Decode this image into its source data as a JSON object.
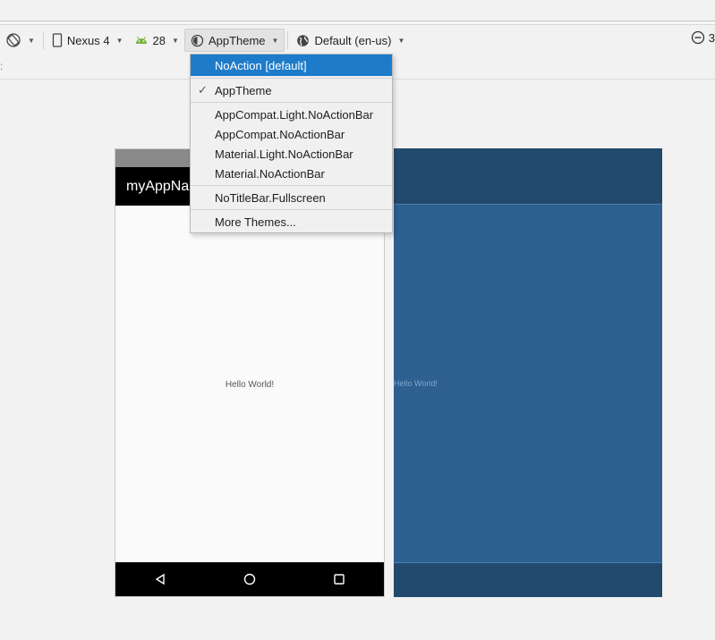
{
  "toolbar": {
    "device": "Nexus 4",
    "api_level": "28",
    "theme": "AppTheme",
    "locale": "Default (en-us)",
    "zoom_fragment": "3"
  },
  "theme_menu": {
    "items": [
      {
        "label": "NoAction [default]"
      },
      {
        "label": "AppTheme"
      },
      {
        "label": "AppCompat.Light.NoActionBar"
      },
      {
        "label": "AppCompat.NoActionBar"
      },
      {
        "label": "Material.Light.NoActionBar"
      },
      {
        "label": "Material.NoActionBar"
      },
      {
        "label": "NoTitleBar.Fullscreen"
      },
      {
        "label": "More Themes..."
      }
    ]
  },
  "preview": {
    "app_title": "myAppNa",
    "hello_text": "Hello World!"
  },
  "blueprint": {
    "hello_text": "Hello World!"
  },
  "colors": {
    "accent": "#1d7bca",
    "blueprint_bg": "#2d5f8f",
    "blueprint_bar": "#224a6d"
  }
}
